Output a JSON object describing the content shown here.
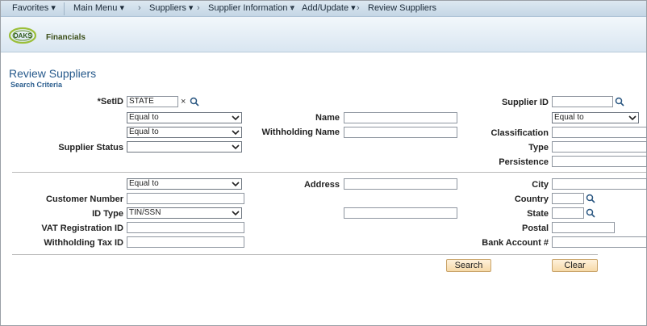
{
  "nav": {
    "favorites": "Favorites",
    "main_menu": "Main Menu",
    "suppliers": "Suppliers",
    "supplier_information": "Supplier Information",
    "add_update": "Add/Update",
    "review_suppliers": "Review Suppliers"
  },
  "banner": {
    "logo_text": "OAKS",
    "product": "Financials"
  },
  "page": {
    "title": "Review Suppliers",
    "subtitle": "Search Criteria"
  },
  "form": {
    "setid": {
      "label": "*SetID",
      "value": "STATE"
    },
    "supplier_id": {
      "label": "Supplier ID",
      "value": "",
      "operator": "Equal to"
    },
    "name": {
      "label": "Name",
      "operator": "Equal to",
      "value": ""
    },
    "withholding_name": {
      "label": "Withholding Name",
      "operator": "Equal to",
      "value": ""
    },
    "classification": {
      "label": "Classification",
      "value": ""
    },
    "supplier_status": {
      "label": "Supplier Status",
      "value": ""
    },
    "type": {
      "label": "Type",
      "value": ""
    },
    "persistence": {
      "label": "Persistence",
      "value": ""
    },
    "address": {
      "label": "Address",
      "operator": "Equal to",
      "value": ""
    },
    "city": {
      "label": "City",
      "value": ""
    },
    "customer_number": {
      "label": "Customer Number",
      "value": ""
    },
    "country": {
      "label": "Country",
      "value": ""
    },
    "id_type": {
      "label": "ID Type",
      "value": "TIN/SSN",
      "id_value": ""
    },
    "state": {
      "label": "State",
      "value": ""
    },
    "vat_registration_id": {
      "label": "VAT Registration ID",
      "value": ""
    },
    "postal": {
      "label": "Postal",
      "value": ""
    },
    "withholding_tax_id": {
      "label": "Withholding Tax ID",
      "value": ""
    },
    "bank_account": {
      "label": "Bank Account #",
      "value": ""
    }
  },
  "buttons": {
    "search": "Search",
    "clear": "Clear"
  },
  "colors": {
    "nav_bg": "#c4d6e5",
    "title": "#26598b",
    "button": "#f6d9a8"
  }
}
